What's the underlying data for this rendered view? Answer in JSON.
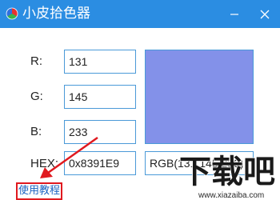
{
  "window": {
    "title": "小皮拾色器",
    "minimize_icon": "minimize-icon",
    "close_icon": "close-icon",
    "title_bar_color": "#2b8de2"
  },
  "color": {
    "r_label": "R:",
    "r_value": "131",
    "g_label": "G:",
    "g_value": "145",
    "b_label": "B:",
    "b_value": "233",
    "hex_label": "HEX:",
    "hex_value": "0x8391E9",
    "rgb_value": "RGB(131,145,233)",
    "preview_color": "#8391e9"
  },
  "help_link": {
    "label": "使用教程",
    "highlight_color": "#e0191f"
  },
  "watermark": {
    "brand": "下载吧",
    "url": "www.xiazaiba.com"
  }
}
